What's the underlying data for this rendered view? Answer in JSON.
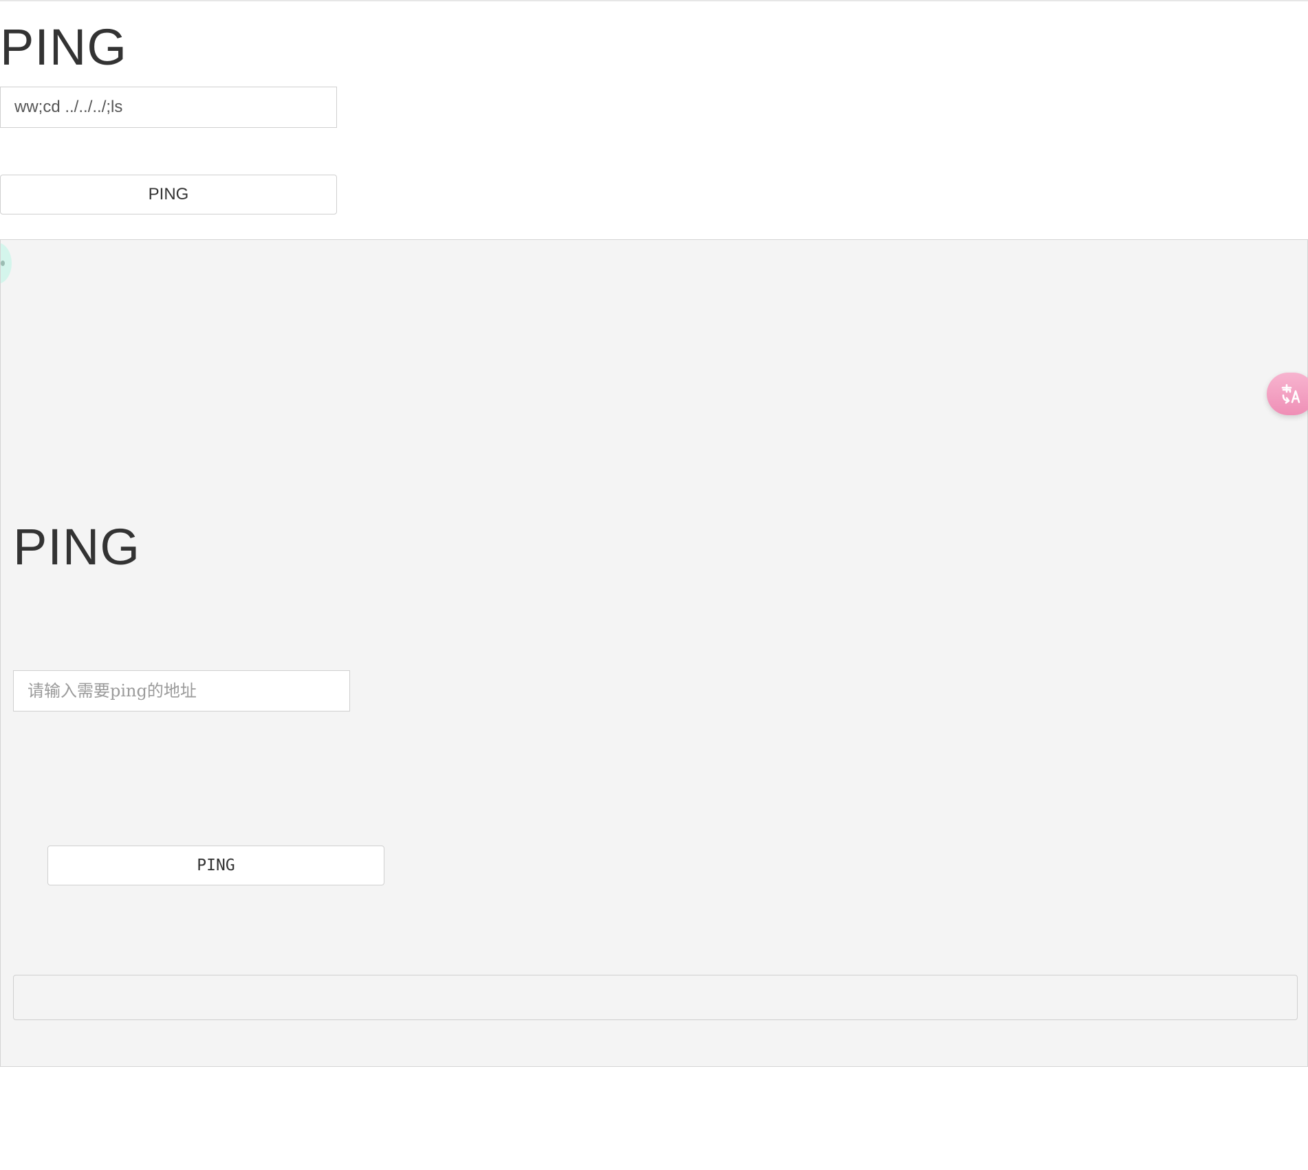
{
  "page": {
    "title": "PING",
    "address_input": {
      "value": "ww;cd ../../../;ls"
    },
    "submit_label": "PING"
  },
  "result_frame": {
    "title": "PING",
    "address_input": {
      "value": "",
      "placeholder": "请输入需要ping的地址"
    },
    "submit_label": "PING",
    "output": ""
  },
  "overlays": {
    "left_widget_icon": "assistant-bubble-icon",
    "translate_icon": "translate-icon",
    "translate_color": "#ef8fb6"
  }
}
